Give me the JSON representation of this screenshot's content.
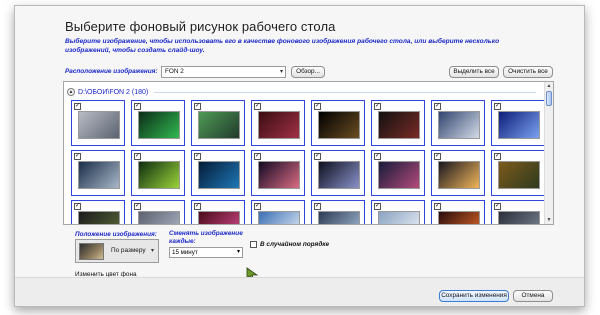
{
  "dialog": {
    "title": "Выберите фоновый рисунок рабочего стола",
    "description": "Выберите изображение, чтобы использовать его в качестве фонового изображения рабочего стола, или выберите несколько изображений, чтобы создать слайд-шоу."
  },
  "location": {
    "label": "Расположение изображения:",
    "value": "FON 2",
    "browse_label": "Обзор...",
    "select_all_label": "Выделить все",
    "clear_all_label": "Очистить все"
  },
  "gallery": {
    "group_name": "D:\\ОБОИ\\FON 2 (180)",
    "collapse_symbol": "▲",
    "checkmark": "✓",
    "rows": [
      [
        {
          "c1": "#b7bcc4",
          "c2": "#5c6270"
        },
        {
          "c1": "#0d2d17",
          "c2": "#2fb850"
        },
        {
          "c1": "#4f9a55",
          "c2": "#213b2c"
        },
        {
          "c1": "#3a0d12",
          "c2": "#a03146"
        },
        {
          "c1": "#000000",
          "c2": "#6a4d22"
        },
        {
          "c1": "#111111",
          "c2": "#7a2b26"
        },
        {
          "c1": "#30446e",
          "c2": "#d3dbe8"
        },
        {
          "c1": "#0f1f7a",
          "c2": "#7aa1f0"
        },
        {
          "c1": "#6d7f4a",
          "c2": "#c2c48f"
        }
      ],
      [
        {
          "c1": "#1b2d49",
          "c2": "#a9b8c9"
        },
        {
          "c1": "#0f2d10",
          "c2": "#9ad33a"
        },
        {
          "c1": "#041b38",
          "c2": "#1f78b6"
        },
        {
          "c1": "#120a22",
          "c2": "#d96c84"
        },
        {
          "c1": "#0e1020",
          "c2": "#8a92c8"
        },
        {
          "c1": "#171c3a",
          "c2": "#b34a7c"
        },
        {
          "c1": "#1a1620",
          "c2": "#f0b65a"
        },
        {
          "c1": "#7c5a1c",
          "c2": "#2e3b1f"
        },
        {
          "c1": "#1d1f2a",
          "c2": "#ffcf5e"
        }
      ],
      [
        {
          "c1": "#1b1b1b",
          "c2": "#5b6a3a"
        },
        {
          "c1": "#5d6170",
          "c2": "#b0b7c7"
        },
        {
          "c1": "#4a0b1a",
          "c2": "#d34a8a"
        },
        {
          "c1": "#3b6fb4",
          "c2": "#e6eef7"
        },
        {
          "c1": "#2e3b54",
          "c2": "#a6bed9"
        },
        {
          "c1": "#8ba3c1",
          "c2": "#ecf1f7"
        },
        {
          "c1": "#2a0b0b",
          "c2": "#e16a2a"
        },
        {
          "c1": "#2b2f3a",
          "c2": "#7d8696"
        },
        {
          "c1": "#0e1c0f",
          "c2": "#6aa34a"
        }
      ]
    ]
  },
  "position": {
    "label": "Положение изображения:",
    "value": "По размеру",
    "arrow": "▾"
  },
  "interval": {
    "label": "Сменять изображение каждые:",
    "value": "15 минут",
    "arrow": "▾"
  },
  "shuffle": {
    "label": "В случайном порядке"
  },
  "change_bg_color_label": "Изменить цвет фона",
  "footer": {
    "save_label": "Сохранить изменения",
    "cancel_label": "Отмена"
  }
}
